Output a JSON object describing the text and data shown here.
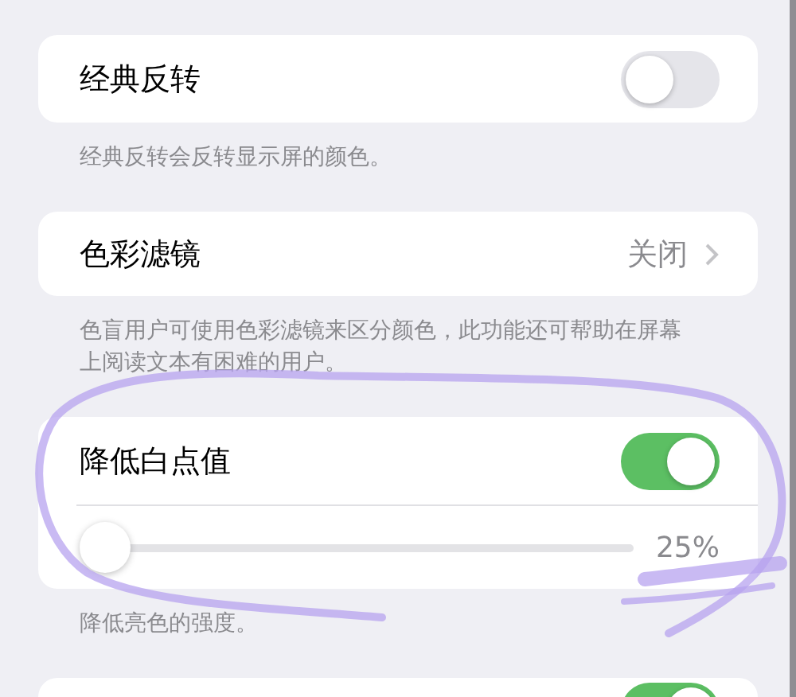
{
  "sections": [
    {
      "rows": [
        {
          "kind": "toggle",
          "label": "经典反转",
          "on": false
        }
      ],
      "footnote": "经典反转会反转显示屏的颜色。"
    },
    {
      "rows": [
        {
          "kind": "link",
          "label": "色彩滤镜",
          "value": "关闭"
        }
      ],
      "footnote": "色盲用户可使用色彩滤镜来区分颜色，此功能还可帮助在屏幕上阅读文本有困难的用户。"
    },
    {
      "rows": [
        {
          "kind": "toggle",
          "label": "降低白点值",
          "on": true
        },
        {
          "kind": "slider",
          "level": 0,
          "reading": "25%"
        }
      ],
      "footnote": "降低亮色的强度。"
    },
    {
      "rows": [
        {
          "kind": "toggle",
          "on": true
        }
      ]
    }
  ]
}
